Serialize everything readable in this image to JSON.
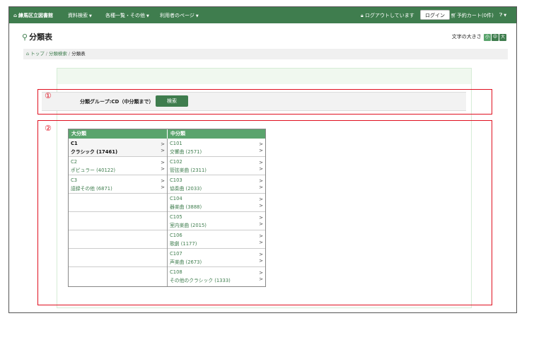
{
  "nav": {
    "home": "練馬区立図書館",
    "menu": [
      "資料検索",
      "各種一覧・その他",
      "利用者のページ"
    ],
    "logout_status": "ログアウトしています",
    "login": "ログイン",
    "cart": "予約カート(0件)"
  },
  "page": {
    "title": "分類表",
    "font_size_label": "文字の大きさ",
    "font_sizes": [
      "小",
      "中",
      "大"
    ]
  },
  "breadcrumb": [
    "トップ",
    "分類検索",
    "分類表"
  ],
  "search": {
    "group_label": "分類グループ:CD（中分類まで）",
    "button": "検索"
  },
  "annotations": [
    "①",
    "②"
  ],
  "table": {
    "headers": [
      "大分類",
      "中分類"
    ],
    "major": [
      {
        "code": "C1",
        "name": "クラシック (17461)",
        "selected": true
      },
      {
        "code": "C2",
        "name": "ポピュラー (40122)"
      },
      {
        "code": "C3",
        "name": "語録その他 (6871)"
      }
    ],
    "middle": [
      {
        "code": "C101",
        "name": "交響曲 (2571)"
      },
      {
        "code": "C102",
        "name": "管弦楽曲 (2311)"
      },
      {
        "code": "C103",
        "name": "協奏曲 (2033)"
      },
      {
        "code": "C104",
        "name": "器楽曲 (3888)"
      },
      {
        "code": "C105",
        "name": "室内楽曲 (2015)"
      },
      {
        "code": "C106",
        "name": "歌劇 (1177)"
      },
      {
        "code": "C107",
        "name": "声楽曲 (2673)"
      },
      {
        "code": "C108",
        "name": "その他のクラシック (1333)"
      }
    ],
    "arrow": ">"
  }
}
